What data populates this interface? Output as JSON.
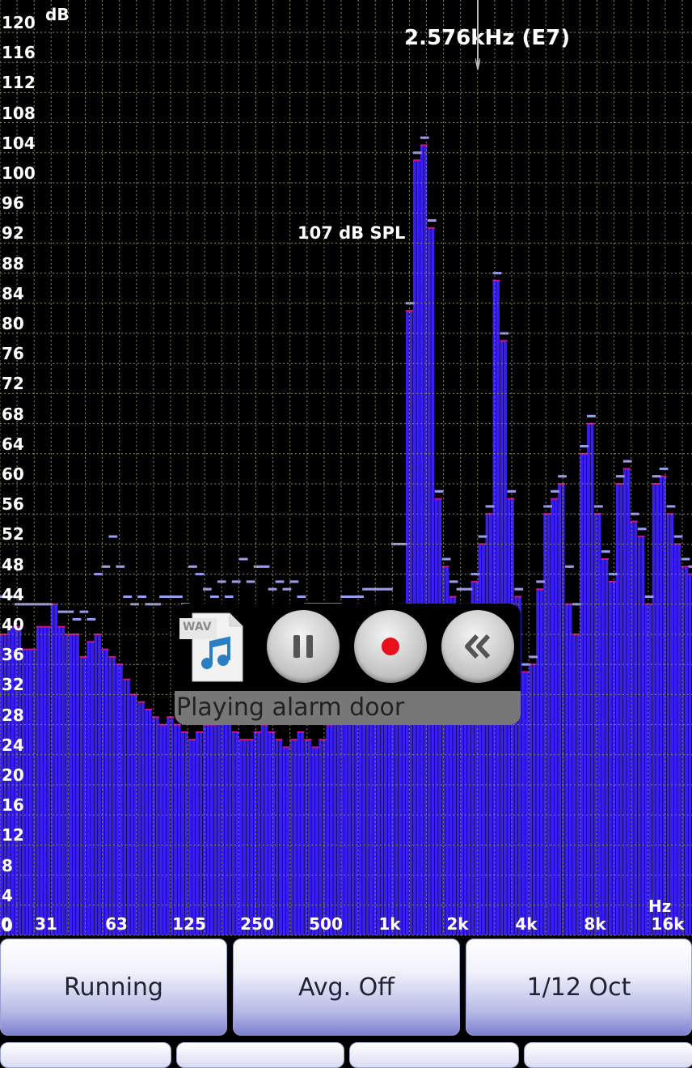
{
  "display": {
    "peak_readout": "2.576kHz (E7)",
    "spl_readout": "107 dB SPL",
    "y_unit": "dB",
    "x_unit": "Hz",
    "bar_color": "#3a1ff5",
    "peak_hold_color": "#9a9cf0",
    "grid_color": "#8a8a5a"
  },
  "player": {
    "file_icon": "wav-file-icon",
    "file_badge": "WAV",
    "status_text": "Playing alarm door",
    "buttons": [
      "pause-icon",
      "record-icon",
      "rewind-icon"
    ]
  },
  "controls": {
    "run_label": "Running",
    "avg_label": "Avg. Off",
    "band_label": "1/12 Oct"
  },
  "chart_data": {
    "type": "bar",
    "xlabel": "Hz",
    "ylabel": "dB",
    "ylim": [
      0,
      124
    ],
    "grid": true,
    "y_ticks": [
      0,
      4,
      8,
      12,
      16,
      20,
      24,
      28,
      32,
      36,
      40,
      44,
      48,
      52,
      56,
      60,
      64,
      68,
      72,
      76,
      80,
      84,
      88,
      92,
      96,
      100,
      104,
      108,
      112,
      116,
      120
    ],
    "x_ticks": [
      "0",
      "31",
      "63",
      "125",
      "250",
      "500",
      "1k",
      "2k",
      "4k",
      "8k",
      "16k"
    ],
    "values": [
      40,
      40,
      41,
      41,
      41,
      41,
      38,
      38,
      38,
      38,
      41,
      41,
      41,
      41,
      44,
      44,
      41,
      41,
      40,
      40,
      40,
      40,
      37,
      37,
      39,
      39,
      40,
      40,
      38,
      38,
      37,
      37,
      36,
      36,
      34,
      34,
      32,
      32,
      31,
      31,
      30,
      30,
      29,
      29,
      28,
      28,
      29,
      29,
      28,
      28,
      27,
      27,
      26,
      26,
      27,
      27,
      28,
      28,
      28,
      28,
      29,
      29,
      29,
      29,
      27,
      27,
      26,
      26,
      26,
      26,
      27,
      27,
      28,
      28,
      27,
      27,
      26,
      26,
      25,
      25,
      26,
      26,
      27,
      27,
      26,
      26,
      25,
      25,
      26,
      26,
      28,
      28,
      29,
      29,
      30,
      30,
      32,
      32,
      33,
      33,
      34,
      34,
      35,
      35,
      36,
      36,
      38,
      38,
      42,
      42,
      44,
      44,
      83,
      83,
      103,
      103,
      105,
      105,
      94,
      94,
      58,
      58,
      49,
      49,
      45,
      45,
      43,
      43,
      44,
      44,
      47,
      47,
      52,
      52,
      56,
      56,
      87,
      87,
      79,
      79,
      58,
      58,
      45,
      45,
      35,
      35,
      36,
      36,
      46,
      46,
      56,
      56,
      58,
      58,
      60,
      60,
      44,
      44,
      40,
      40,
      64,
      64,
      68,
      68,
      56,
      56,
      50,
      50,
      47,
      47,
      60,
      60,
      62,
      62,
      55,
      55,
      53,
      53,
      44,
      44,
      60,
      60,
      61,
      61,
      56,
      56,
      52,
      52,
      49,
      49,
      48
    ],
    "peak_hold": [
      45,
      45,
      45,
      45,
      44,
      44,
      44,
      44,
      44,
      44,
      44,
      44,
      44,
      44,
      44,
      44,
      43,
      43,
      43,
      43,
      42,
      42,
      43,
      43,
      42,
      42,
      48,
      48,
      49,
      49,
      53,
      53,
      49,
      49,
      45,
      45,
      44,
      44,
      45,
      45,
      44,
      44,
      44,
      44,
      45,
      45,
      45,
      45,
      45,
      45,
      44,
      44,
      49,
      49,
      48,
      48,
      46,
      46,
      45,
      45,
      47,
      47,
      45,
      45,
      47,
      47,
      50,
      50,
      47,
      47,
      49,
      49,
      49,
      49,
      46,
      46,
      47,
      47,
      46,
      46,
      47,
      47,
      45,
      45,
      44,
      44,
      44,
      44,
      44,
      44,
      44,
      44,
      44,
      44,
      45,
      45,
      45,
      45,
      45,
      45,
      46,
      46,
      46,
      46,
      46,
      46,
      46,
      46,
      52,
      52,
      52,
      52,
      84,
      84,
      104,
      104,
      106,
      106,
      95,
      95,
      59,
      59,
      50,
      50,
      47,
      47,
      46,
      46,
      46,
      46,
      48,
      48,
      53,
      53,
      57,
      57,
      88,
      88,
      80,
      80,
      59,
      59,
      46,
      46,
      36,
      36,
      37,
      37,
      47,
      47,
      57,
      57,
      59,
      59,
      61,
      61,
      49,
      49,
      44,
      44,
      65,
      65,
      69,
      69,
      57,
      57,
      51,
      51,
      48,
      48,
      61,
      61,
      63,
      63,
      56,
      56,
      54,
      54,
      45,
      45,
      61,
      61,
      62,
      62,
      57,
      57,
      53,
      53,
      50,
      50,
      49
    ]
  }
}
